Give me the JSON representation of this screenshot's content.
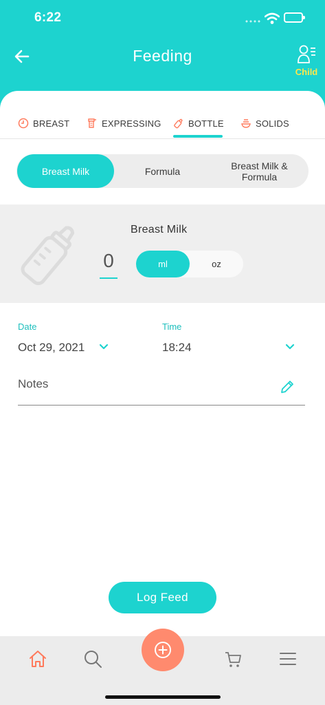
{
  "status_bar": {
    "time": "6:22"
  },
  "header": {
    "title": "Feeding",
    "child_label": "Child"
  },
  "tabs": [
    {
      "label": "BREAST"
    },
    {
      "label": "EXPRESSING"
    },
    {
      "label": "BOTTLE"
    },
    {
      "label": "SOLIDS"
    }
  ],
  "selected_tab": "BOTTLE",
  "milk_type": {
    "options": [
      "Breast Milk",
      "Formula",
      "Breast Milk & Formula"
    ],
    "selected": "Breast Milk"
  },
  "amount": {
    "title": "Breast Milk",
    "value": "0",
    "units": [
      "ml",
      "oz"
    ],
    "selected_unit": "ml"
  },
  "date": {
    "label": "Date",
    "value": "Oct 29, 2021"
  },
  "time_field": {
    "label": "Time",
    "value": "18:24"
  },
  "notes": {
    "placeholder": "Notes"
  },
  "log_button": "Log Feed",
  "colors": {
    "accent": "#1dd3cf",
    "action": "#ff8a6e",
    "child_label": "#ffe74a"
  },
  "bottom_nav": [
    "home-icon",
    "search-icon",
    "add-icon",
    "cart-icon",
    "menu-icon"
  ]
}
